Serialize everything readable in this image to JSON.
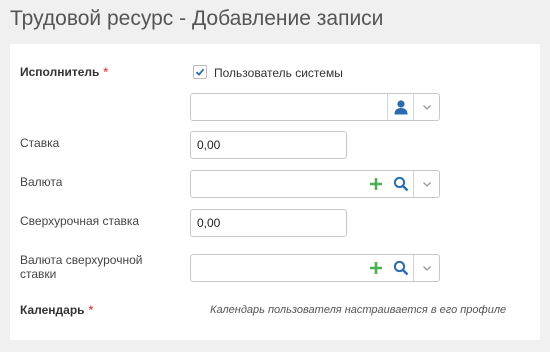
{
  "page": {
    "title": "Трудовой ресурс - Добавление записи"
  },
  "form": {
    "executor": {
      "label": "Исполнитель",
      "required_mark": "*",
      "checkbox_label": "Пользователь системы",
      "checkbox_checked": true,
      "value": "",
      "icons": [
        "user-icon",
        "chevron-down-icon"
      ]
    },
    "rate": {
      "label": "Ставка",
      "value": "0,00"
    },
    "currency": {
      "label": "Валюта",
      "value": "",
      "icons": [
        "plus-icon",
        "search-icon",
        "chevron-down-icon"
      ]
    },
    "overtime_rate": {
      "label": "Сверхурочная ставка",
      "value": "0,00"
    },
    "overtime_currency": {
      "label_line1": "Валюта сверхурочной",
      "label_line2": "ставки",
      "value": "",
      "icons": [
        "plus-icon",
        "search-icon",
        "chevron-down-icon"
      ]
    },
    "calendar": {
      "label": "Календарь",
      "required_mark": "*",
      "hint": "Календарь пользователя настраивается в его профиле"
    }
  },
  "colors": {
    "accent_blue": "#2b6cb0",
    "add_green": "#4caf50",
    "required_red": "#d9534f"
  }
}
